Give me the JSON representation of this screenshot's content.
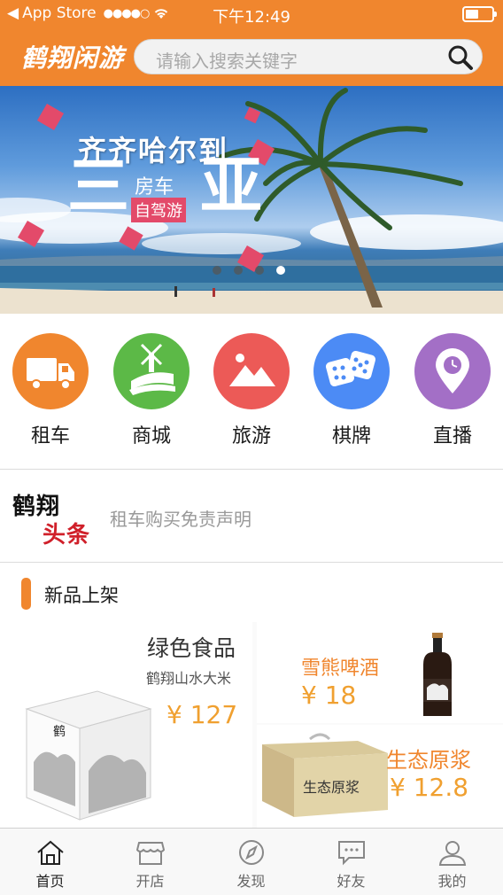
{
  "status_bar": {
    "carrier": "App Store",
    "time": "下午12:49"
  },
  "header": {
    "logo": "鹤翔闲游",
    "search_placeholder": "请输入搜索关键字"
  },
  "banner": {
    "line1": "齐齐哈尔到",
    "big_left": "三",
    "mid": "房车",
    "tag": "自驾游",
    "big_right": "亚",
    "page_count": 4,
    "active_index": 3
  },
  "categories": [
    {
      "label": "租车",
      "icon": "truck-icon",
      "color": "#f0862e"
    },
    {
      "label": "商城",
      "icon": "windmill-field-icon",
      "color": "#5cb947"
    },
    {
      "label": "旅游",
      "icon": "mountain-icon",
      "color": "#ec5a57"
    },
    {
      "label": "棋牌",
      "icon": "dice-icon",
      "color": "#4c8bf5"
    },
    {
      "label": "直播",
      "icon": "location-clock-icon",
      "color": "#a36fc6"
    }
  ],
  "news": {
    "brand_top": "鹤翔",
    "brand_bottom": "头条",
    "text": "租车购买免责声明"
  },
  "section": {
    "title": "新品上架"
  },
  "products": [
    {
      "title": "绿色食品",
      "subtitle": "鹤翔山水大米",
      "price": "¥ 127"
    },
    {
      "title": "雪熊啤酒",
      "price": "¥ 18"
    },
    {
      "title": "生态原浆",
      "price": "¥ 12.8",
      "box_text": "生态原浆"
    }
  ],
  "tabs": [
    {
      "label": "首页",
      "icon": "home-icon",
      "active": true
    },
    {
      "label": "开店",
      "icon": "shop-icon",
      "active": false
    },
    {
      "label": "发现",
      "icon": "compass-icon",
      "active": false
    },
    {
      "label": "好友",
      "icon": "chat-icon",
      "active": false
    },
    {
      "label": "我的",
      "icon": "user-icon",
      "active": false
    }
  ],
  "colors": {
    "brand": "#f0862e",
    "price": "#f0a030",
    "news_red": "#d0202a"
  }
}
